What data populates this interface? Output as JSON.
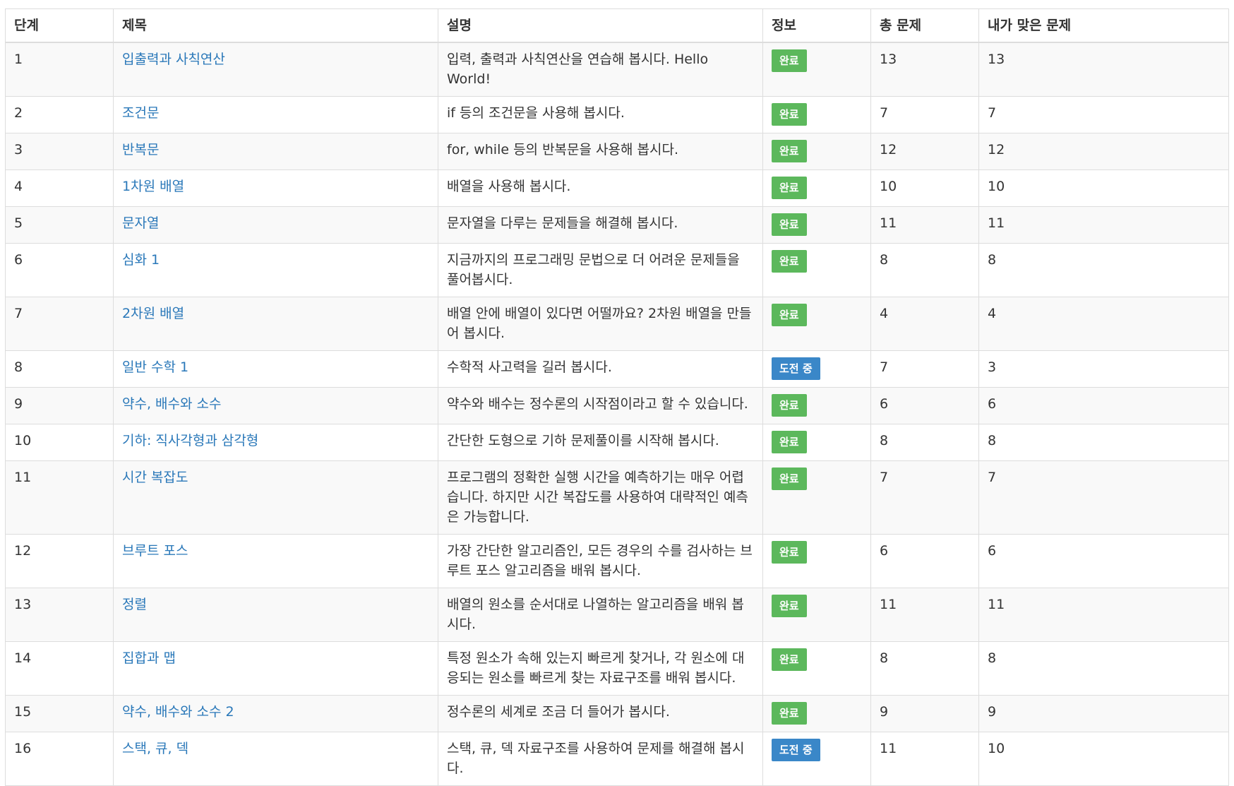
{
  "colors": {
    "link": "#2a78b9",
    "badge_done": "#5cb85c",
    "badge_in_progress": "#3a87c8",
    "row_stripe": "#f9f9f9",
    "border": "#dddddd"
  },
  "table": {
    "headers": [
      "단계",
      "제목",
      "설명",
      "정보",
      "총 문제",
      "내가 맞은 문제"
    ],
    "rows": [
      {
        "step": "1",
        "title": "입출력과 사칙연산",
        "desc": "입력, 출력과 사칙연산을 연습해 봅시다. Hello World!",
        "status": "완료",
        "status_type": "done",
        "total": "13",
        "solved": "13"
      },
      {
        "step": "2",
        "title": "조건문",
        "desc": "if 등의 조건문을 사용해 봅시다.",
        "status": "완료",
        "status_type": "done",
        "total": "7",
        "solved": "7"
      },
      {
        "step": "3",
        "title": "반복문",
        "desc": "for, while 등의 반복문을 사용해 봅시다.",
        "status": "완료",
        "status_type": "done",
        "total": "12",
        "solved": "12"
      },
      {
        "step": "4",
        "title": "1차원 배열",
        "desc": "배열을 사용해 봅시다.",
        "status": "완료",
        "status_type": "done",
        "total": "10",
        "solved": "10"
      },
      {
        "step": "5",
        "title": "문자열",
        "desc": "문자열을 다루는 문제들을 해결해 봅시다.",
        "status": "완료",
        "status_type": "done",
        "total": "11",
        "solved": "11"
      },
      {
        "step": "6",
        "title": "심화 1",
        "desc": "지금까지의 프로그래밍 문법으로 더 어려운 문제들을 풀어봅시다.",
        "status": "완료",
        "status_type": "done",
        "total": "8",
        "solved": "8"
      },
      {
        "step": "7",
        "title": "2차원 배열",
        "desc": "배열 안에 배열이 있다면 어떨까요? 2차원 배열을 만들어 봅시다.",
        "status": "완료",
        "status_type": "done",
        "total": "4",
        "solved": "4"
      },
      {
        "step": "8",
        "title": "일반 수학 1",
        "desc": "수학적 사고력을 길러 봅시다.",
        "status": "도전 중",
        "status_type": "in_progress",
        "total": "7",
        "solved": "3"
      },
      {
        "step": "9",
        "title": "약수, 배수와 소수",
        "desc": "약수와 배수는 정수론의 시작점이라고 할 수 있습니다.",
        "status": "완료",
        "status_type": "done",
        "total": "6",
        "solved": "6"
      },
      {
        "step": "10",
        "title": "기하: 직사각형과 삼각형",
        "desc": "간단한 도형으로 기하 문제풀이를 시작해 봅시다.",
        "status": "완료",
        "status_type": "done",
        "total": "8",
        "solved": "8"
      },
      {
        "step": "11",
        "title": "시간 복잡도",
        "desc": "프로그램의 정확한 실행 시간을 예측하기는 매우 어렵습니다. 하지만 시간 복잡도를 사용하여 대략적인 예측은 가능합니다.",
        "status": "완료",
        "status_type": "done",
        "total": "7",
        "solved": "7"
      },
      {
        "step": "12",
        "title": "브루트 포스",
        "desc": "가장 간단한 알고리즘인, 모든 경우의 수를 검사하는 브루트 포스 알고리즘을 배워 봅시다.",
        "status": "완료",
        "status_type": "done",
        "total": "6",
        "solved": "6"
      },
      {
        "step": "13",
        "title": "정렬",
        "desc": "배열의 원소를 순서대로 나열하는 알고리즘을 배워 봅시다.",
        "status": "완료",
        "status_type": "done",
        "total": "11",
        "solved": "11"
      },
      {
        "step": "14",
        "title": "집합과 맵",
        "desc": "특정 원소가 속해 있는지 빠르게 찾거나, 각 원소에 대응되는 원소를 빠르게 찾는 자료구조를 배워 봅시다.",
        "status": "완료",
        "status_type": "done",
        "total": "8",
        "solved": "8"
      },
      {
        "step": "15",
        "title": "약수, 배수와 소수 2",
        "desc": "정수론의 세계로 조금 더 들어가 봅시다.",
        "status": "완료",
        "status_type": "done",
        "total": "9",
        "solved": "9"
      },
      {
        "step": "16",
        "title": "스택, 큐, 덱",
        "desc": "스택, 큐, 덱 자료구조를 사용하여 문제를 해결해 봅시다.",
        "status": "도전 중",
        "status_type": "in_progress",
        "total": "11",
        "solved": "10"
      }
    ]
  }
}
